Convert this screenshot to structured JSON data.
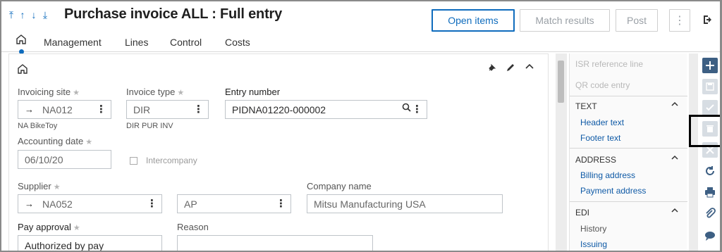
{
  "header": {
    "nav_arrows": [
      "⤒",
      "↑",
      "↓",
      "⤓"
    ],
    "title": "Purchase invoice ALL : Full entry",
    "buttons": {
      "open_items": "Open items",
      "match_results": "Match results",
      "post": "Post",
      "more": "⋮"
    },
    "logout_icon": "sign-out-icon"
  },
  "tabs": [
    "Management",
    "Lines",
    "Control",
    "Costs"
  ],
  "form": {
    "invoicing_site": {
      "label": "Invoicing site",
      "value": "NA012",
      "sub": "NA BikeToy"
    },
    "invoice_type": {
      "label": "Invoice type",
      "value": "DIR",
      "sub": "DIR PUR INV"
    },
    "entry_number": {
      "label": "Entry number",
      "value": "PIDNA01220-000002"
    },
    "accounting_date": {
      "label": "Accounting date",
      "value": "06/10/20"
    },
    "intercompany": {
      "label": "Intercompany",
      "checked": false
    },
    "supplier": {
      "label": "Supplier",
      "value": "NA052"
    },
    "supplier_type": {
      "value": "AP"
    },
    "company_name": {
      "label": "Company name",
      "value": "Mitsu Manufacturing USA"
    },
    "pay_approval": {
      "label": "Pay approval",
      "value": "Authorized by pay"
    },
    "reason": {
      "label": "Reason",
      "value": ""
    }
  },
  "right_panel": {
    "isr_reference_line": "ISR reference line",
    "qr_code_entry": "QR code entry",
    "sections": [
      {
        "title": "TEXT",
        "items": [
          "Header text",
          "Footer text"
        ]
      },
      {
        "title": "ADDRESS",
        "items": [
          "Billing address",
          "Payment address"
        ]
      },
      {
        "title": "EDI",
        "items": [
          "History",
          "Issuing"
        ]
      }
    ]
  },
  "toolbar_icons": [
    "add-icon",
    "save-icon",
    "check-icon",
    "delete-icon",
    "close-icon",
    "refresh-icon",
    "print-icon",
    "attachment-icon",
    "comment-icon"
  ],
  "colors": {
    "accent": "#0f6cbd",
    "toolbar": "#3d5f83",
    "link": "#0f5aa6"
  }
}
